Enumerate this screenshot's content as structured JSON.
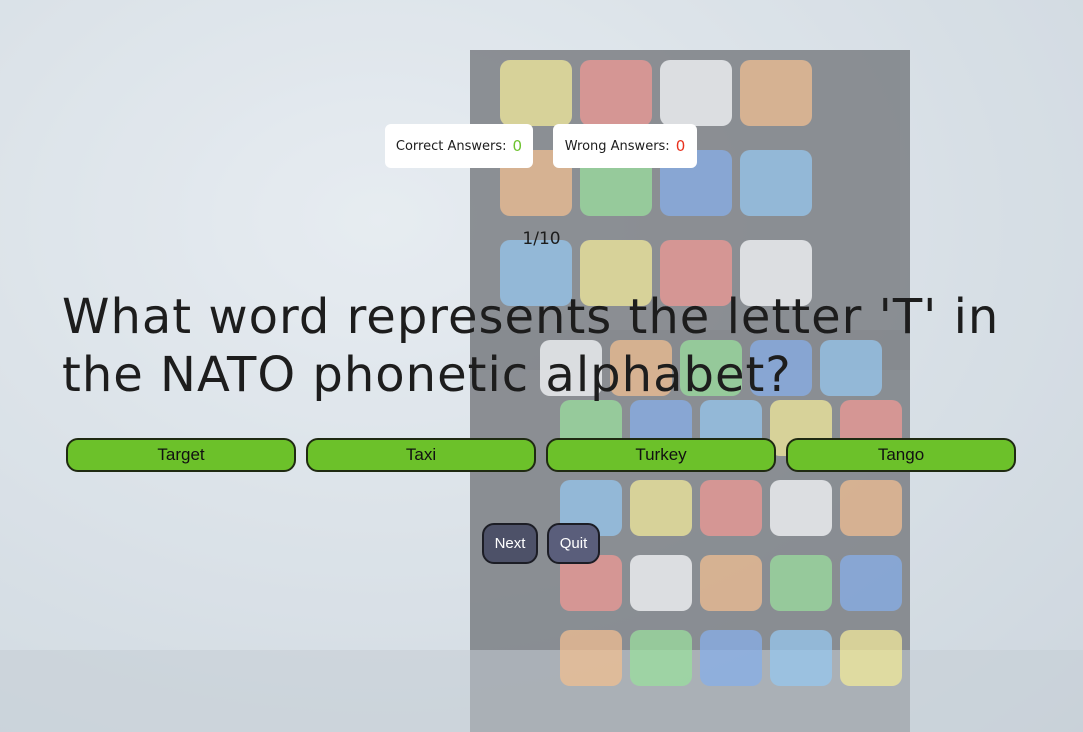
{
  "scoreboard": {
    "correct_label": "Correct Answers:",
    "correct_count": "0",
    "wrong_label": "Wrong Answers:",
    "wrong_count": "0"
  },
  "progress": "1/10",
  "question": "What word represents the letter 'T' in the NATO phonetic alphabet?",
  "answers": [
    {
      "label": "Target"
    },
    {
      "label": "Taxi"
    },
    {
      "label": "Turkey"
    },
    {
      "label": "Tango"
    }
  ],
  "controls": {
    "next_label": "Next",
    "quit_label": "Quit"
  },
  "colors": {
    "answer_green": "#6cc12a",
    "correct_green": "#6dc22e",
    "wrong_red": "#e8311d",
    "control_slate": "#4d5168"
  }
}
